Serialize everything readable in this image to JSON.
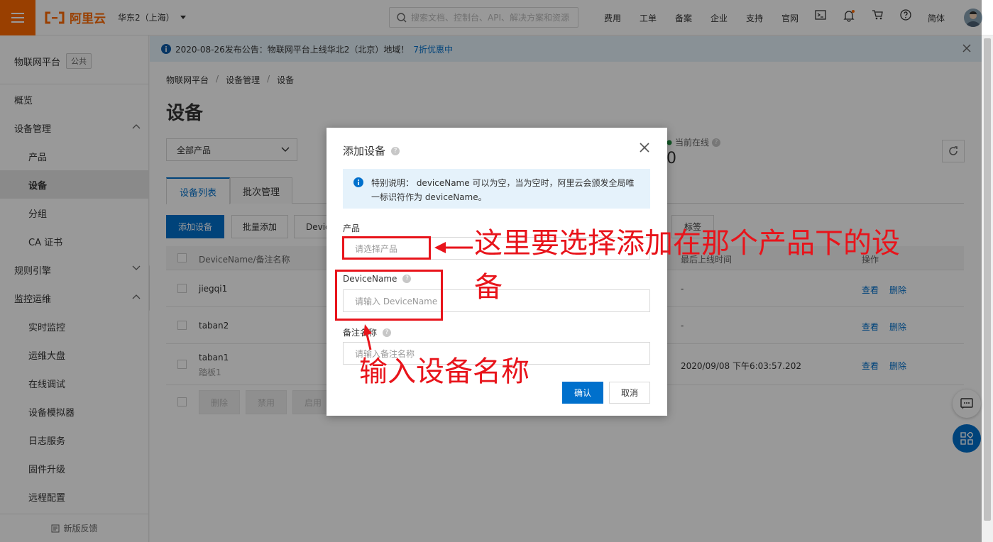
{
  "topbar": {
    "logo_text": "阿里云",
    "region": "华东2（上海）",
    "search_placeholder": "搜索文档、控制台、API、解决方案和资源",
    "nav": [
      "费用",
      "工单",
      "备案",
      "企业",
      "支持",
      "官网"
    ],
    "lang": "简体"
  },
  "sidebar": {
    "title": "物联网平台",
    "tag": "公共",
    "items": [
      {
        "label": "概览",
        "level": 1
      },
      {
        "label": "设备管理",
        "level": 1,
        "expanded": true
      },
      {
        "label": "产品",
        "level": 2
      },
      {
        "label": "设备",
        "level": 2,
        "active": true
      },
      {
        "label": "分组",
        "level": 2
      },
      {
        "label": "CA 证书",
        "level": 2
      },
      {
        "label": "规则引擎",
        "level": 1,
        "expanded": false
      },
      {
        "label": "监控运维",
        "level": 1,
        "expanded": true
      },
      {
        "label": "实时监控",
        "level": 2
      },
      {
        "label": "运维大盘",
        "level": 2
      },
      {
        "label": "在线调试",
        "level": 2
      },
      {
        "label": "设备模拟器",
        "level": 2
      },
      {
        "label": "日志服务",
        "level": 2
      },
      {
        "label": "固件升级",
        "level": 2
      },
      {
        "label": "远程配置",
        "level": 2
      }
    ],
    "footer": "新版反馈"
  },
  "notice": {
    "text": "2020-08-26发布公告：物联网平台上线华北2（北京）地域！",
    "link": "7折优惠中"
  },
  "page": {
    "breadcrumb": [
      "物联网平台",
      "设备管理",
      "设备"
    ],
    "title": "设备",
    "product_select": "全部产品",
    "stat_label": "当前在线",
    "stat_value": "0",
    "tabs": [
      "设备列表",
      "批次管理"
    ],
    "add_button": "添加设备",
    "batch_button": "批量添加",
    "filter_partial": "Devic",
    "filter_tag_partial": "标签",
    "columns": [
      "DeviceName/备注名称",
      "最后上线时间",
      "操作"
    ],
    "rows": [
      {
        "name": "jiegqi1",
        "note": "",
        "last_online": "-"
      },
      {
        "name": "taban2",
        "note": "",
        "last_online": "-"
      },
      {
        "name": "taban1",
        "note": "踏板1",
        "last_online": "2020/09/08 下午6:03:57.202"
      }
    ],
    "op_view": "查看",
    "op_delete": "删除",
    "bulk_buttons": [
      "删除",
      "禁用",
      "启用"
    ]
  },
  "modal": {
    "title": "添加设备",
    "info": "特别说明： deviceName 可以为空，当为空时，阿里云会颁发全局唯一标识符作为 deviceName。",
    "product_label": "产品",
    "product_placeholder": "请选择产品",
    "devicename_label": "DeviceName",
    "devicename_placeholder": "请输入 DeviceName",
    "note_label": "备注名称",
    "note_placeholder": "请输入备注名称",
    "confirm": "确认",
    "cancel": "取消"
  },
  "annotations": {
    "text1": "这里要选择添加在那个产品下的设",
    "text1b": "备",
    "text2": "输入设备名称",
    "color": "#e8141b"
  }
}
